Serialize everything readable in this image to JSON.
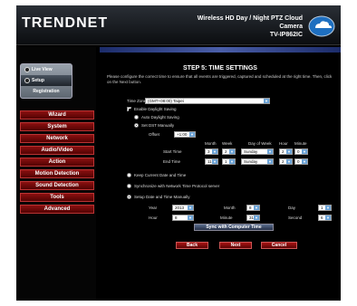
{
  "header": {
    "logo": "TRENDNET",
    "title_line1": "Wireless HD Day / Night PTZ Cloud Camera",
    "title_line2": "TV-IP862IC",
    "cloud_label": "TRENDnet Cloud"
  },
  "sidebar": {
    "login": [
      {
        "label": "Live View"
      },
      {
        "label": "Setup"
      },
      {
        "label": "Registration"
      }
    ],
    "menu": [
      {
        "label": "Wizard"
      },
      {
        "label": "System"
      },
      {
        "label": "Network"
      },
      {
        "label": "Audio/Video"
      },
      {
        "label": "Action"
      },
      {
        "label": "Motion Detection"
      },
      {
        "label": "Sound Detection"
      },
      {
        "label": "Tools"
      },
      {
        "label": "Advanced"
      }
    ]
  },
  "main": {
    "step_title": "STEP 5: TIME SETTINGS",
    "intro": "Please configure the correct time to ensure that all events are triggered, captured and scheduled at the right time. Then, click on the Next button.",
    "timezone_label": "Time Zone",
    "timezone_value": "(GMT+08:00) Taipei",
    "daylight_label": "Enable Daylight Saving",
    "auto_daylight": "Auto Daylight Saving",
    "set_dst": "Set DST Manually",
    "offset_label": "Offset",
    "offset_value": "+1:00",
    "dst_headers": [
      "Month",
      "Week",
      "Day of Week",
      "Hour",
      "Minute"
    ],
    "start_label": "Start Time",
    "start_vals": [
      "3",
      "2",
      "Sunday",
      "2",
      "0"
    ],
    "end_label": "End Time",
    "end_vals": [
      "11",
      "1",
      "Sunday",
      "2",
      "0"
    ],
    "keep_time": "Keep Current Date and Time",
    "sync_ntp": "Synchronize with Network Time Protocol server",
    "setup_manual": "Setup Date and Time Manually",
    "year_label": "Year",
    "year_value": "2013",
    "month_label": "Month",
    "month_value": "8",
    "day_label": "Day",
    "day_value": "1",
    "hour_label": "Hour",
    "hour_value": "8",
    "minute_label": "Minute",
    "minute_value": "31",
    "second_label": "Second",
    "second_value": "6",
    "sync_pc_btn": "Sync with Computer Time",
    "back_btn": "Back",
    "next_btn": "Next",
    "cancel_btn": "Cancel"
  }
}
